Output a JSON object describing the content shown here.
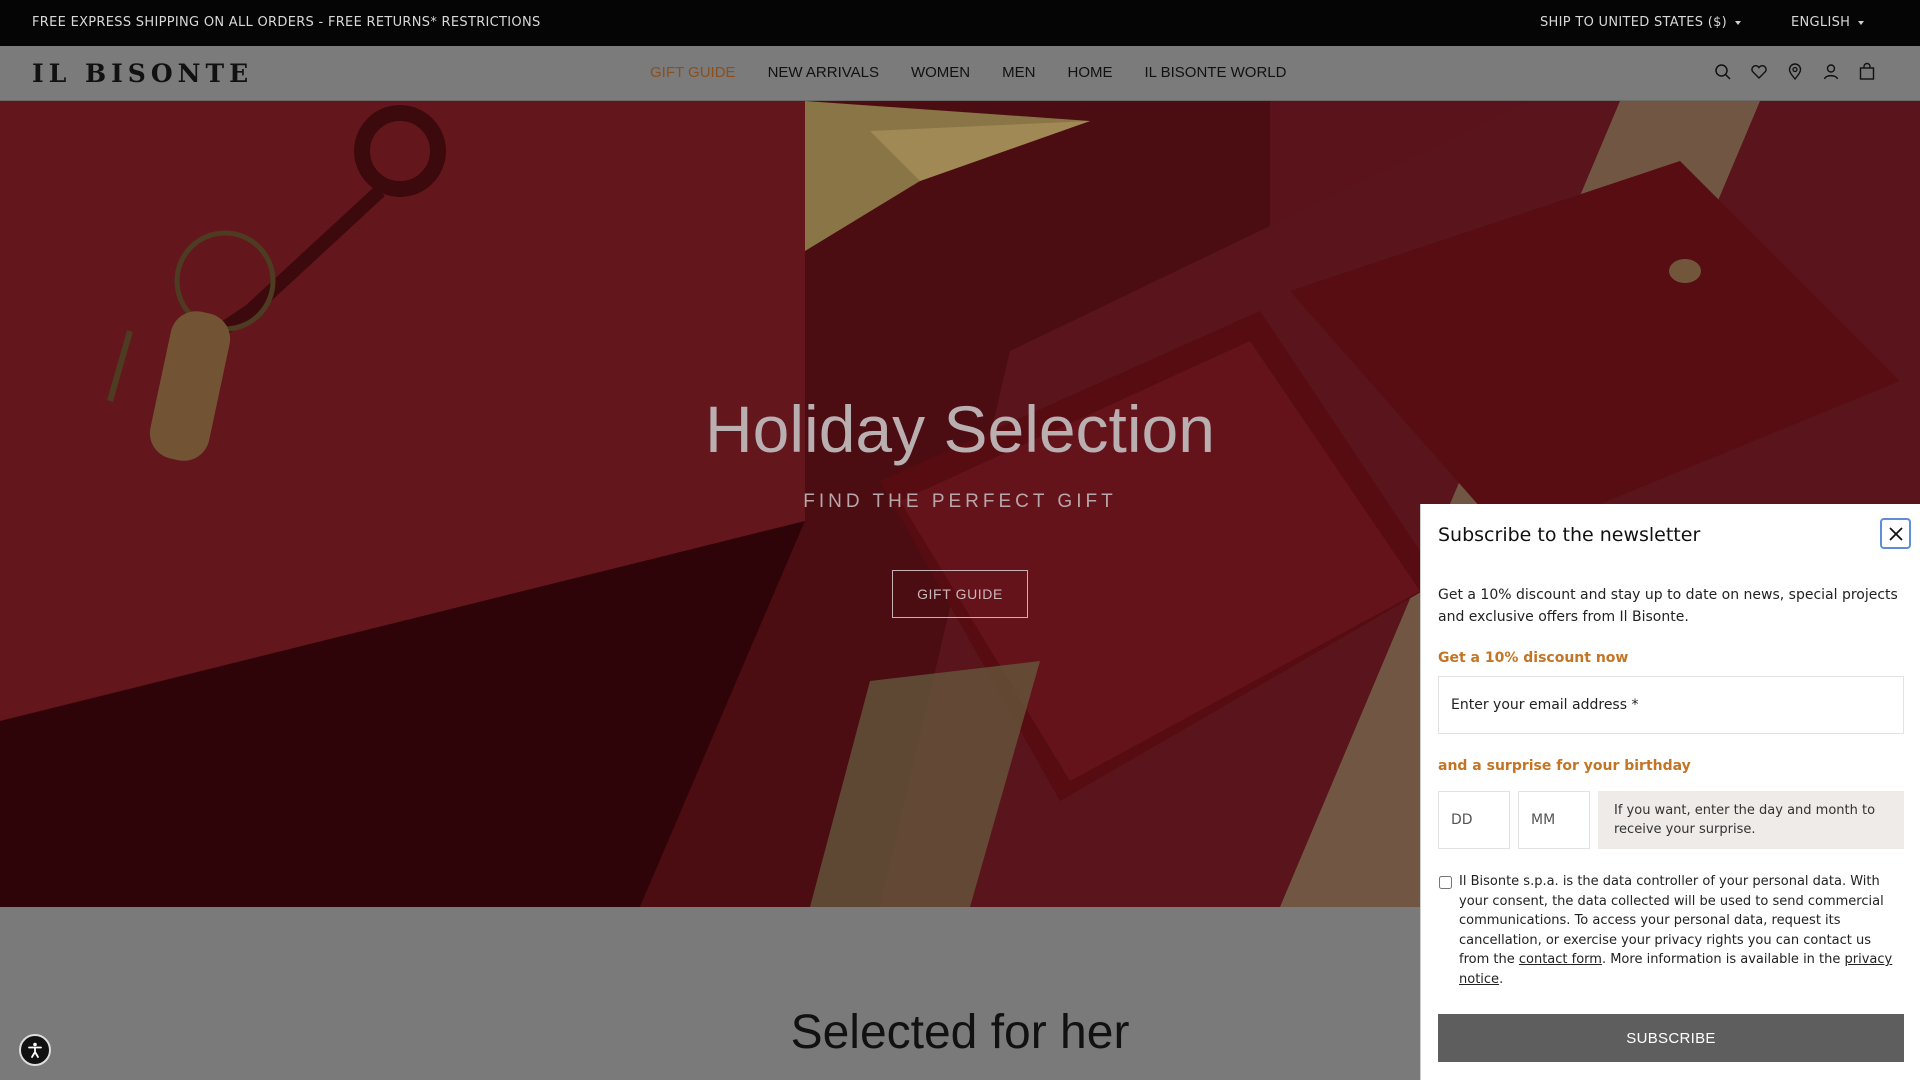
{
  "topbar": {
    "promo": "FREE EXPRESS SHIPPING ON ALL ORDERS - FREE RETURNS* RESTRICTIONS",
    "ship_to": "SHIP TO UNITED STATES ($)",
    "language": "ENGLISH"
  },
  "header": {
    "logo": "IL BISONTE",
    "nav": [
      "GIFT GUIDE",
      "NEW ARRIVALS",
      "WOMEN",
      "MEN",
      "HOME",
      "IL BISONTE WORLD"
    ],
    "icons": [
      "search-icon",
      "heart-icon",
      "location-icon",
      "user-icon",
      "bag-icon"
    ]
  },
  "hero": {
    "title": "Holiday Selection",
    "subtitle": "FIND THE PERFECT GIFT",
    "button": "GIFT GUIDE"
  },
  "section": {
    "title": "Selected for her"
  },
  "newsletter": {
    "title": "Subscribe to the newsletter",
    "description": "Get a 10% discount and stay up to date on news, special projects and exclusive offers from Il Bisonte.",
    "discount_heading": "Get a 10% discount now",
    "email_placeholder": "Enter your email address *",
    "birthday_heading": "and a surprise for your birthday",
    "day_placeholder": "DD",
    "month_placeholder": "MM",
    "birthday_hint": "If you want, enter the day and month to receive your surprise.",
    "consent_before": "Il Bisonte s.p.a. is the data controller of your personal data. With your consent, the data collected will be used to send commercial communications. To access your personal data, request its cancellation, or exercise your privacy rights you can contact us from the ",
    "consent_link1": "contact form",
    "consent_middle": ". More information is available in the ",
    "consent_link2": "privacy notice",
    "consent_end": ".",
    "subscribe_button": "SUBSCRIBE"
  },
  "colors": {
    "accent": "#c37525",
    "nav_active": "#8a4f1c",
    "topbar_bg": "#050505",
    "hero_red": "#7a1a22"
  }
}
